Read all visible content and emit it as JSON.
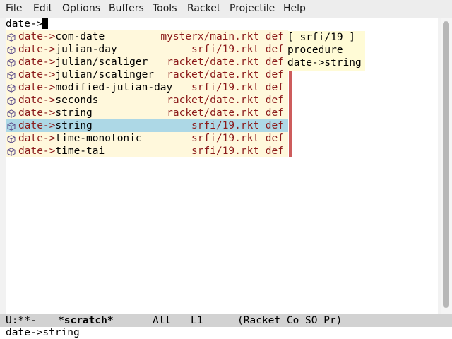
{
  "menubar": {
    "items": [
      "File",
      "Edit",
      "Options",
      "Buffers",
      "Tools",
      "Racket",
      "Projectile",
      "Help"
    ]
  },
  "buffer": {
    "input_text": "date->"
  },
  "completion": {
    "prefix": "date->",
    "selected_index": 7,
    "items": [
      {
        "suffix": "com-date",
        "annotation": "mysterx/main.rkt def"
      },
      {
        "suffix": "julian-day",
        "annotation": "srfi/19.rkt def"
      },
      {
        "suffix": "julian/scaliger",
        "annotation": "racket/date.rkt def"
      },
      {
        "suffix": "julian/scalinger",
        "annotation": "racket/date.rkt def"
      },
      {
        "suffix": "modified-julian-day",
        "annotation": "srfi/19.rkt def"
      },
      {
        "suffix": "seconds",
        "annotation": "racket/date.rkt def"
      },
      {
        "suffix": "string",
        "annotation": "racket/date.rkt def"
      },
      {
        "suffix": "string",
        "annotation": "srfi/19.rkt def"
      },
      {
        "suffix": "time-monotonic",
        "annotation": "srfi/19.rkt def"
      },
      {
        "suffix": "time-tai",
        "annotation": "srfi/19.rkt def"
      }
    ],
    "item_icon": "cube-icon",
    "colors": {
      "background": "#fff8dc",
      "selected_background": "#add8e6",
      "annotation": "#8b1a1a",
      "scrollbar": "#cd5c5c"
    }
  },
  "doc_popup": {
    "line1": "[ srfi/19 ]",
    "line2": "procedure",
    "line3": "date->string"
  },
  "modeline": {
    "status": "U:**-",
    "buffer_name": "*scratch*",
    "position": "All",
    "line": "L1",
    "modes": "(Racket Co SO Pr)"
  },
  "minibuffer": {
    "text": "date->string"
  }
}
